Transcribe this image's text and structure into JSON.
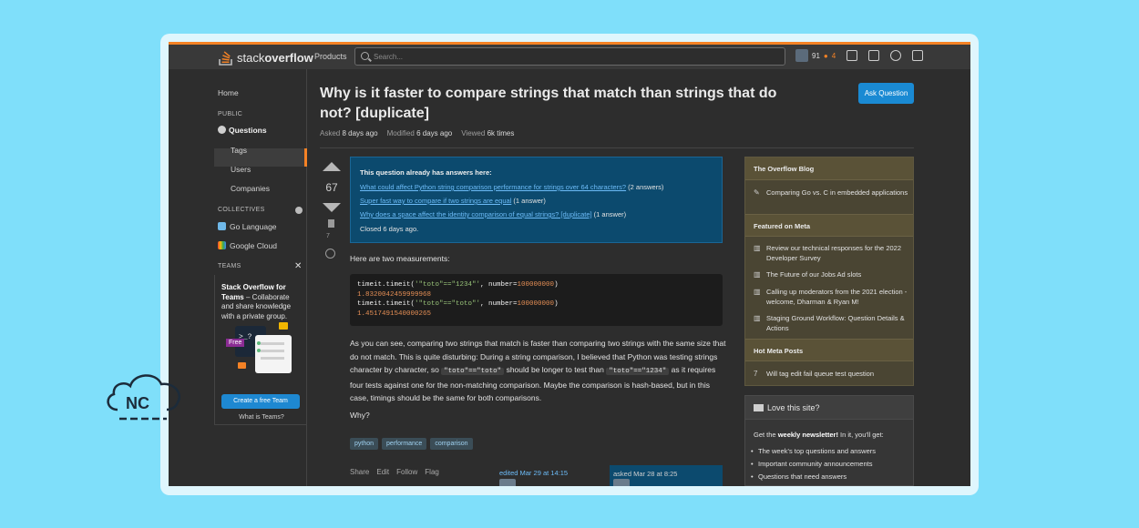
{
  "topbar": {
    "logo_prefix": "stack",
    "logo_bold": "overflow",
    "products": "Products",
    "search_placeholder": "Search...",
    "reputation": "91",
    "bronze_badges": "4"
  },
  "leftnav": {
    "home": "Home",
    "public_label": "PUBLIC",
    "questions": "Questions",
    "tags": "Tags",
    "users": "Users",
    "companies": "Companies",
    "collectives_label": "COLLECTIVES",
    "collective_1": "Go Language",
    "collective_2": "Google Cloud",
    "teams_label": "TEAMS",
    "teams_title_bold": "Stack Overflow for Teams",
    "teams_title_rest": " – Collaborate and share knowledge with a private group.",
    "teams_free": "Free",
    "teams_button": "Create a free Team",
    "teams_link": "What is Teams?"
  },
  "question": {
    "title": "Why is it faster to compare strings that match than strings that do not? [duplicate]",
    "ask_button": "Ask Question",
    "asked_label": "Asked",
    "asked_value": "8 days ago",
    "modified_label": "Modified",
    "modified_value": "6 days ago",
    "viewed_label": "Viewed",
    "viewed_value": "6k times",
    "votes": "67",
    "bookmarks": "7",
    "duplicate_heading": "This question already has answers here:",
    "dup_links": [
      {
        "text": "What could affect Python string comparison performance for strings over 64 characters?",
        "answers": " (2 answers)"
      },
      {
        "text": "Super fast way to compare if two strings are equal",
        "answers": " (1 answer)"
      },
      {
        "text": "Why does a space affect the identity comparison of equal strings? [duplicate]",
        "answers": " (1 answer)"
      }
    ],
    "closed": "Closed 6 days ago.",
    "intro": "Here are two measurements:",
    "code": {
      "l1_call": "timeit.timeit(",
      "l1_str": "'\"toto\"==\"1234\"'",
      "l1_rest": ", number=",
      "l1_num": "100000000",
      "l1_end": ")",
      "l2": "1.8320042459999968",
      "l3_call": "timeit.timeit(",
      "l3_str": "'\"toto\"==\"toto\"'",
      "l3_rest": ", number=",
      "l3_num": "100000000",
      "l3_end": ")",
      "l4": "1.4517491540000265"
    },
    "para_1": "As you can see, comparing two strings that match is faster than comparing two strings with the same size that do not match. This is quite disturbing: During a string comparison, I believed that Python was testing strings character by character, so",
    "inline_1": "\"toto\"==\"toto\"",
    "para_2": "should be longer to test than",
    "inline_2": "\"toto\"==\"1234\"",
    "para_3": "as it requires four tests against one for the non-matching comparison. Maybe the comparison is hash-based, but in this case, timings should be the same for both comparisons.",
    "why": "Why?",
    "tags": [
      "python",
      "performance",
      "comparison"
    ],
    "actions": [
      "Share",
      "Edit",
      "Follow",
      "Flag"
    ],
    "edited": "edited Mar 29 at 14:15",
    "asked_card": "asked Mar 28 at 8:25"
  },
  "sidebar": {
    "blog_head": "The Overflow Blog",
    "blog_item": "Comparing Go vs. C in embedded applications",
    "meta_head": "Featured on Meta",
    "meta_items": [
      "Review our technical responses for the 2022 Developer Survey",
      "The Future of our Jobs Ad slots",
      "Calling up moderators from the 2021 election - welcome, Dharman & Ryan M!",
      "Staging Ground Workflow: Question Details & Actions"
    ],
    "hot_head": "Hot Meta Posts",
    "hot_count": "7",
    "hot_item": "Will tag edit fail queue test question",
    "love_title": "Love this site?",
    "love_pre": "Get the ",
    "love_bold": "weekly newsletter!",
    "love_post": " In it, you'll get:",
    "love_items": [
      "The week's top questions and answers",
      "Important community announcements",
      "Questions that need answers"
    ]
  },
  "watermark": {
    "text": "NC"
  }
}
